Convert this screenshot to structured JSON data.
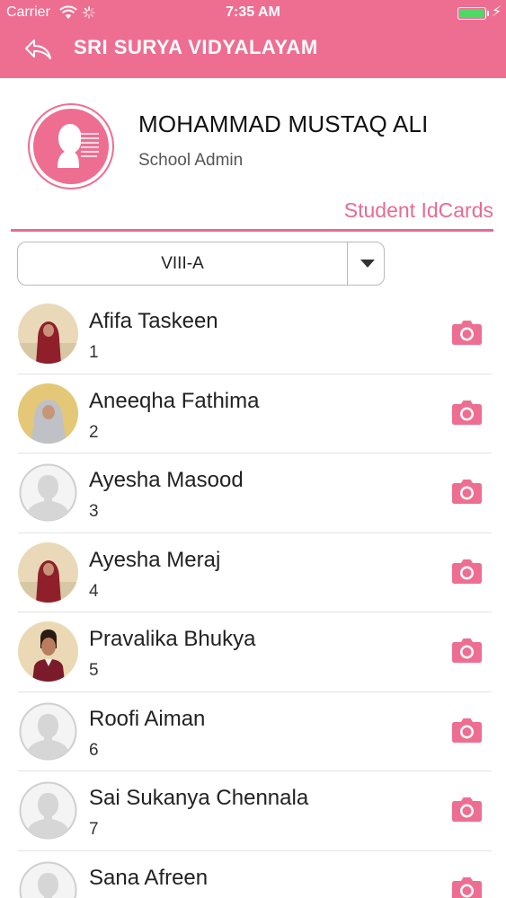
{
  "status_bar": {
    "carrier": "Carrier",
    "time": "7:35 AM"
  },
  "header": {
    "title": "SRI SURYA VIDYALAYAM",
    "back_icon": "reply-arrow-icon",
    "color": "#ee6e92"
  },
  "profile": {
    "name": "MOHAMMAD MUSTAQ ALI",
    "role": "School Admin",
    "avatar_icon": "user-profile-icon"
  },
  "section": {
    "title": "Student IdCards",
    "accent": "#e86b91"
  },
  "class_select": {
    "value": "VIII-A"
  },
  "students": [
    {
      "name": "Afifa Taskeen",
      "roll": "1",
      "photo": "photo-hijab-red"
    },
    {
      "name": "Aneeqha Fathima",
      "roll": "2",
      "photo": "photo-hijab-grey"
    },
    {
      "name": "Ayesha Masood",
      "roll": "3",
      "photo": "placeholder"
    },
    {
      "name": "Ayesha Meraj",
      "roll": "4",
      "photo": "photo-hijab-red"
    },
    {
      "name": "Pravalika Bhukya",
      "roll": "5",
      "photo": "photo-uniform"
    },
    {
      "name": "Roofi Aiman",
      "roll": "6",
      "photo": "placeholder"
    },
    {
      "name": "Sai Sukanya Chennala",
      "roll": "7",
      "photo": "placeholder"
    },
    {
      "name": "Sana Afreen",
      "roll": "",
      "photo": "placeholder"
    }
  ]
}
